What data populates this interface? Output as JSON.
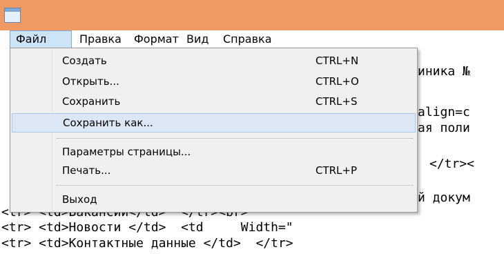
{
  "menubar": {
    "items": [
      {
        "label": "Файл"
      },
      {
        "label": "Правка"
      },
      {
        "label": "Формат"
      },
      {
        "label": "Вид"
      },
      {
        "label": "Справка"
      }
    ]
  },
  "file_menu": {
    "items": [
      {
        "label": "Создать",
        "shortcut": "CTRL+N"
      },
      {
        "label": "Открыть...",
        "shortcut": "CTRL+O"
      },
      {
        "label": "Сохранить",
        "shortcut": "CTRL+S"
      },
      {
        "label": "Сохранить как...",
        "shortcut": ""
      },
      {
        "label": "Параметры страницы...",
        "shortcut": ""
      },
      {
        "label": "Печать...",
        "shortcut": "CTRL+P"
      },
      {
        "label": "Выход",
        "shortcut": ""
      }
    ]
  },
  "editor": {
    "lines": [
      "иника №",
      "align=c",
      "ая поли",
      "</tr><",
      "й докум",
      "<tr> <td>Вакансии</td>  </tr><br>",
      "<tr> <td>Новости </td>  <td     Width=\"",
      "<tr> <td>Контактные данные </td>  </tr>"
    ]
  }
}
